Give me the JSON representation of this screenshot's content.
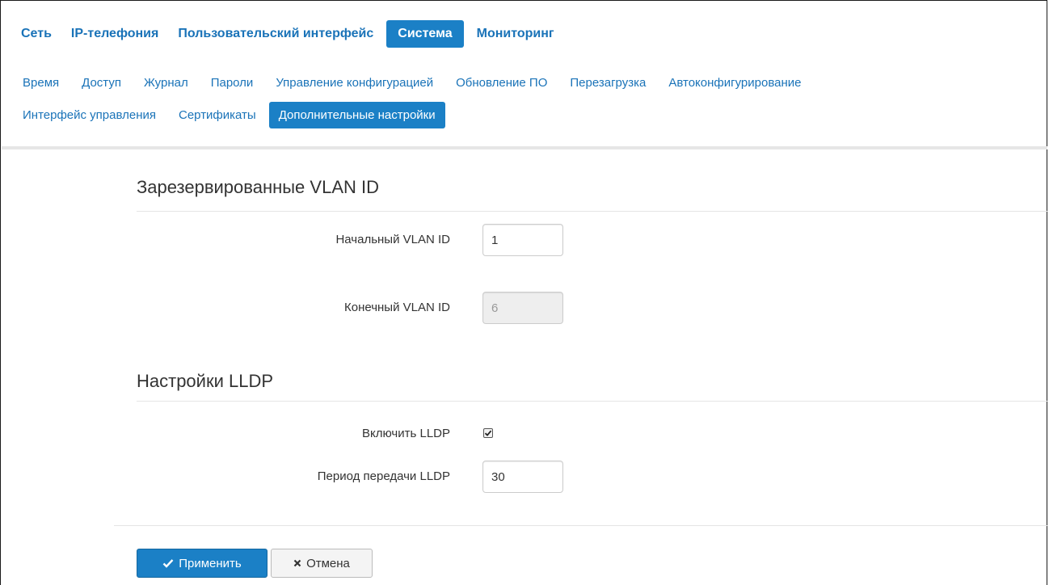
{
  "main_nav": {
    "items": [
      {
        "label": "Сеть"
      },
      {
        "label": "IP-телефония"
      },
      {
        "label": "Пользовательский интерфейс"
      },
      {
        "label": "Система",
        "active": true
      },
      {
        "label": "Мониторинг"
      }
    ]
  },
  "sub_nav": {
    "items": [
      {
        "label": "Время"
      },
      {
        "label": "Доступ"
      },
      {
        "label": "Журнал"
      },
      {
        "label": "Пароли"
      },
      {
        "label": "Управление конфигурацией"
      },
      {
        "label": "Обновление ПО"
      },
      {
        "label": "Перезагрузка"
      },
      {
        "label": "Автоконфигурирование"
      },
      {
        "label": "Интерфейс управления"
      },
      {
        "label": "Сертификаты"
      },
      {
        "label": "Дополнительные настройки",
        "active": true
      }
    ]
  },
  "vlan_section": {
    "title": "Зарезервированные VLAN ID",
    "start_label": "Начальный VLAN ID",
    "start_value": "1",
    "end_label": "Конечный VLAN ID",
    "end_value": "6"
  },
  "lldp_section": {
    "title": "Настройки LLDP",
    "enable_label": "Включить LLDP",
    "enable_checked": true,
    "period_label": "Период передачи LLDP",
    "period_value": "30"
  },
  "actions": {
    "apply_label": "Применить",
    "cancel_label": "Отмена"
  },
  "colors": {
    "accent": "#1b80c6",
    "link": "#1a73b8"
  },
  "icons": {
    "apply": "check-icon",
    "cancel": "close-icon"
  }
}
